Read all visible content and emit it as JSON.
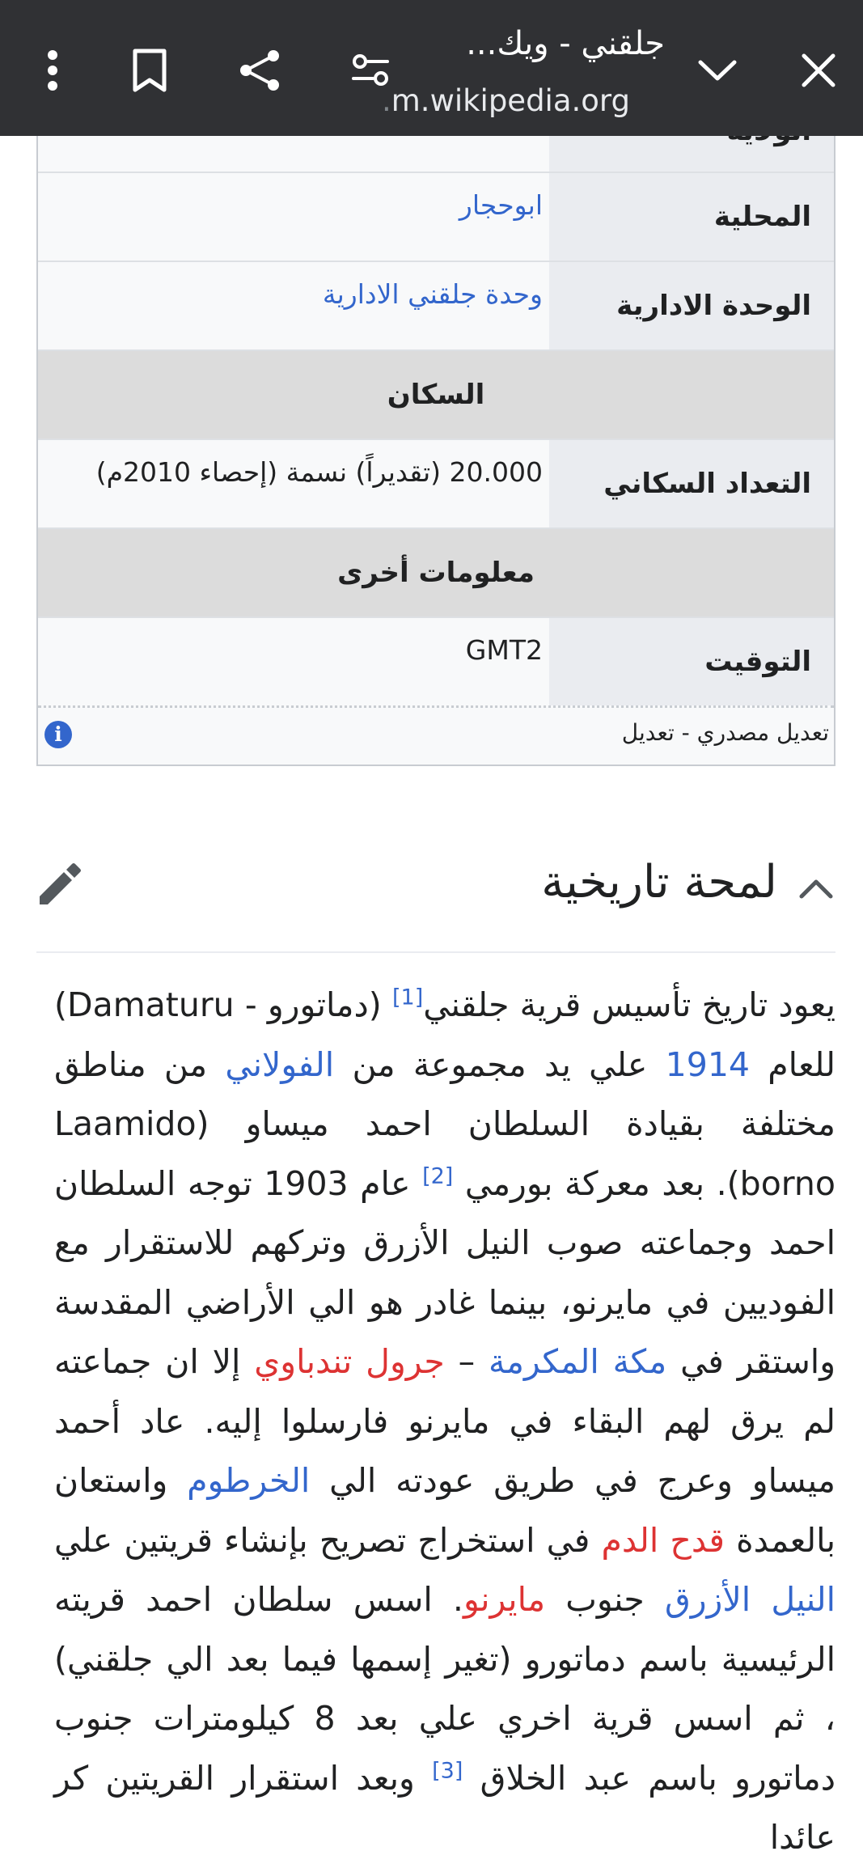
{
  "toolbar": {
    "title": "جلقني - ويك...",
    "url_fade": ".",
    "url": "m.wikipedia.org",
    "icons": [
      "close-icon",
      "chevron-down-icon",
      "page-settings-icon",
      "share-icon",
      "bookmark-icon",
      "more-vert-icon"
    ]
  },
  "infobox": {
    "partial_row_label": "الولاية",
    "rows": [
      {
        "label": "المحلية",
        "value": "ابوحجار"
      },
      {
        "label": "الوحدة الادارية",
        "value": "وحدة جلقني الادارية"
      }
    ],
    "population_header": "السكان",
    "population_label": "التعداد السكاني",
    "population_value": "20.000 (تقديراً) نسمة (إحصاء 2010م)",
    "other_header": "معلومات أخرى",
    "timezone_label": "التوقيت",
    "timezone_value": "GMT2",
    "edit_links": "تعديل مصدري - تعديل"
  },
  "section": {
    "title": "لمحة تاريخية"
  },
  "article": {
    "t1": "يعود تاريخ تأسيس قرية جلقني",
    "ref1": "[1]",
    "t2": " (دماتورو - Damaturu) للعام ",
    "link_1914": "1914",
    "t3": " علي يد مجموعة من ",
    "link_fulani": "الفولاني",
    "t4": " من مناطق مختلفة بقيادة السلطان احمد ميساو (Laamido borno). بعد معركة بورمي ",
    "ref2": "[2]",
    "t5": " عام 1903 توجه السلطان احمد وجماعته صوب النيل الأزرق وتركهم للاستقرار مع الفوديين في مايرنو، بينما غادر هو الي الأراضي المقدسة واستقر في ",
    "link_mecca": "مكة المكرمة",
    "t6": " – ",
    "link_jarol": "جرول تندباوي",
    "t7": " إلا ان جماعته لم يرق لهم البقاء في مايرنو فارسلوا إليه. عاد أحمد ميساو وعرج في طريق عودته الي ",
    "link_khartoum": "الخرطوم",
    "t8": " واستعان بالعمدة ",
    "link_qadah": "قدح الدم",
    "t9": " في استخراج تصريح بإنشاء قريتين علي ",
    "link_bluenile": "النيل الأزرق",
    "t10": " جنوب ",
    "link_mayrno": "مايرنو",
    "t11": ". اسس سلطان احمد قريته الرئيسية باسم دماتورو (تغير إسمها فيما بعد الي جلقني) ، ثم اسس قرية اخري علي بعد 8 كيلومترات جنوب دماتورو باسم عبد الخلاق ",
    "ref3": "[3]",
    "t12": " وبعد استقرار القريتين كر عائدا"
  },
  "colors": {
    "toolbar_bg": "#303134",
    "link": "#3366cc",
    "redlink": "#dd3333",
    "info_icon": "#3366cc"
  }
}
